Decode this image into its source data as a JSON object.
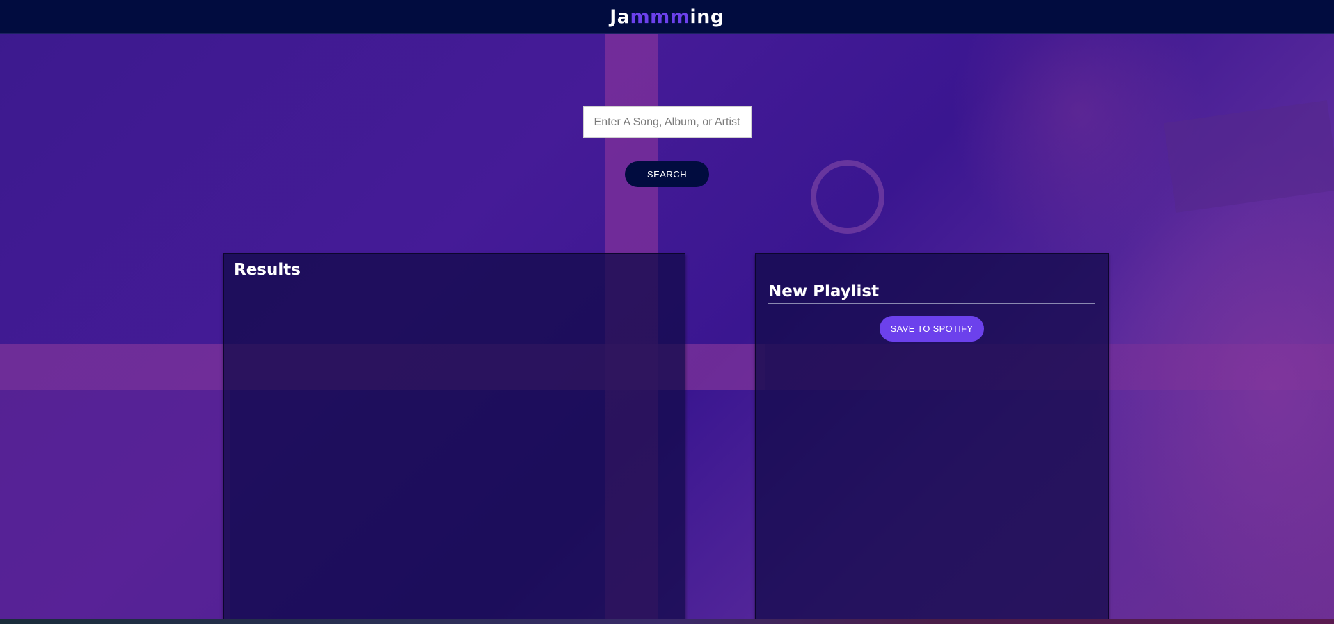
{
  "header": {
    "logo_prefix": "Ja",
    "logo_highlight": "mmm",
    "logo_suffix": "ing"
  },
  "search": {
    "placeholder": "Enter A Song, Album, or Artist",
    "value": "",
    "button_label": "SEARCH"
  },
  "results": {
    "title": "Results",
    "tracks": []
  },
  "playlist": {
    "name": "New Playlist",
    "save_label": "SAVE TO SPOTIFY",
    "tracks": []
  },
  "colors": {
    "header_bg": "#010c3f",
    "accent": "#6c41ec",
    "background": "#3a1690"
  }
}
